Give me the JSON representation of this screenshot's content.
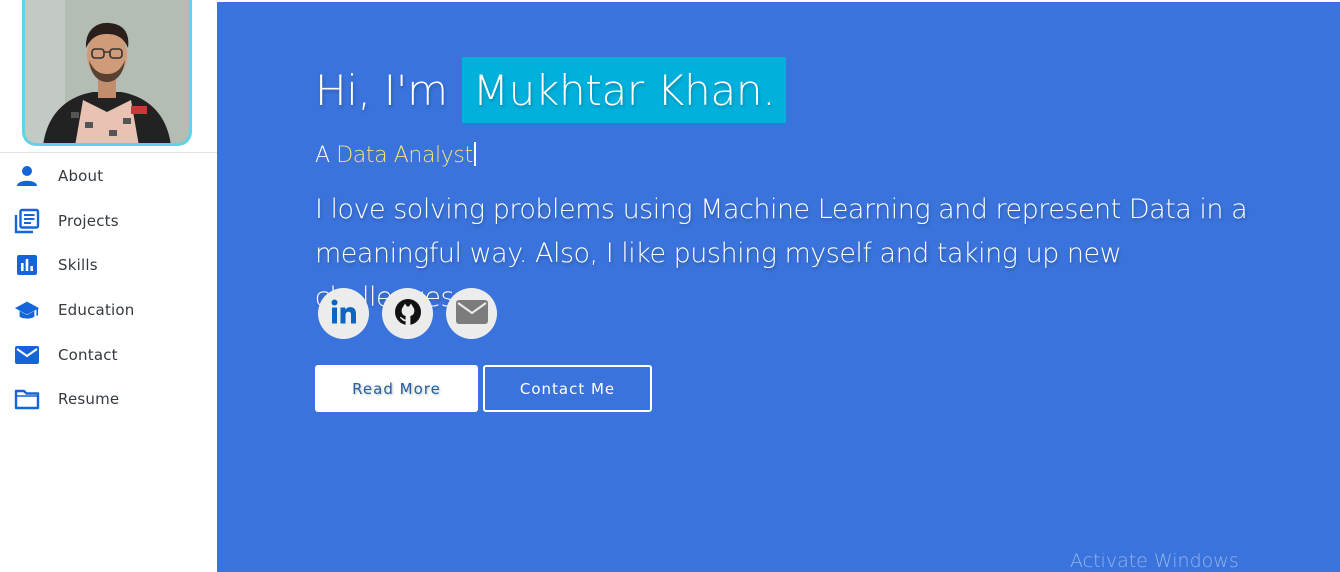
{
  "sidebar": {
    "avatar_alt": "profile photo",
    "items": [
      {
        "label": "About",
        "icon": "person-icon"
      },
      {
        "label": "Projects",
        "icon": "library-books-icon"
      },
      {
        "label": "Skills",
        "icon": "bar-chart-icon"
      },
      {
        "label": "Education",
        "icon": "graduation-cap-icon"
      },
      {
        "label": "Contact",
        "icon": "mail-icon"
      },
      {
        "label": "Resume",
        "icon": "folder-icon"
      }
    ]
  },
  "hero": {
    "greeting": "Hi, I'm",
    "name": "Mukhtar Khan.",
    "role_prefix": "A",
    "role": "Data Analyst",
    "bio": "I love solving problems using Machine Learning and represent Data in a meaningful way. Also, I like pushing myself and taking up new challenges.",
    "social": [
      {
        "icon": "linkedin-icon"
      },
      {
        "icon": "github-icon"
      },
      {
        "icon": "mail-icon"
      }
    ],
    "read_more_label": "Read More",
    "contact_label": "Contact Me"
  },
  "overlay": {
    "watermark": "Activate Windows"
  },
  "colors": {
    "main_bg": "#3a73db",
    "name_highlight": "#01b1dc",
    "role_accent": "#fbe27a",
    "nav_icon": "#1565d8",
    "avatar_border": "#5fd3ea"
  }
}
